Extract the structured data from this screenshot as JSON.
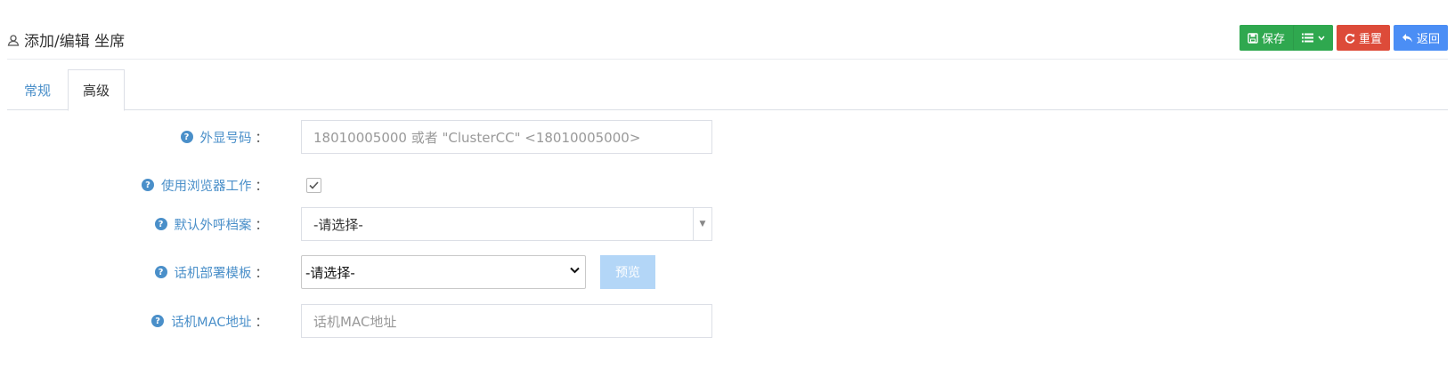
{
  "header": {
    "title": "添加/编辑 坐席",
    "save_label": "保存",
    "reset_label": "重置",
    "back_label": "返回"
  },
  "colors": {
    "save": "#2fa84f",
    "reset": "#dd4b39",
    "back": "#4b8ef5",
    "label": "#4a8fc9",
    "preview": "#b3d6f7"
  },
  "tabs": [
    {
      "label": "常规",
      "active": false
    },
    {
      "label": "高级",
      "active": true
    }
  ],
  "form": {
    "caller_id": {
      "label": "外显号码",
      "value": "",
      "placeholder": "18010005000 或者 \"ClusterCC\" <18010005000>"
    },
    "use_browser": {
      "label": "使用浏览器工作",
      "checked": true
    },
    "default_profile": {
      "label": "默认外呼档案",
      "value": "-请选择-"
    },
    "phone_template": {
      "label": "话机部署模板",
      "value": "-请选择-",
      "preview_label": "预览"
    },
    "phone_mac": {
      "label": "话机MAC地址",
      "value": "",
      "placeholder": "话机MAC地址"
    }
  },
  "colon": "："
}
